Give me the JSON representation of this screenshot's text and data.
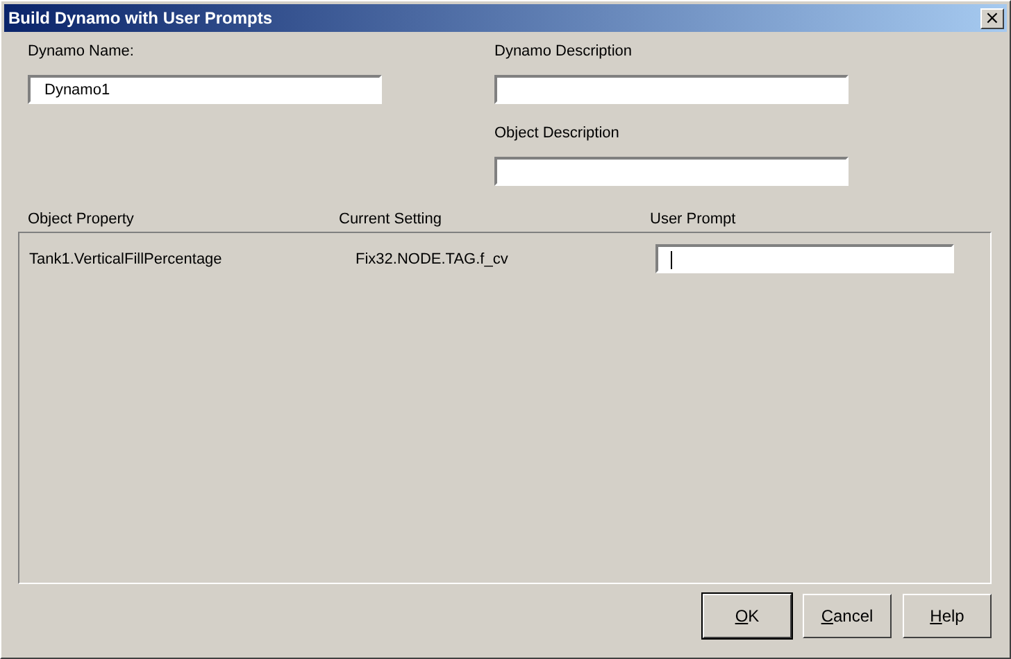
{
  "window": {
    "title": "Build Dynamo with User Prompts",
    "close": "×"
  },
  "fields": {
    "dynamo_name": {
      "label": "Dynamo Name:",
      "value": "Dynamo1"
    },
    "dynamo_description": {
      "label": "Dynamo Description"
    },
    "object_description": {
      "label": "Object Description"
    }
  },
  "table": {
    "columns": [
      "Object Property",
      "Current Setting",
      "User Prompt"
    ],
    "rows": [
      {
        "property": "Tank1.VerticalFillPercentage",
        "setting": "Fix32.NODE.TAG.f_cv",
        "focused": true
      }
    ]
  },
  "buttons": [
    {
      "label": "OK",
      "default": true
    },
    {
      "label": "Cancel",
      "default": false
    },
    {
      "label": "Help",
      "default": false
    }
  ]
}
